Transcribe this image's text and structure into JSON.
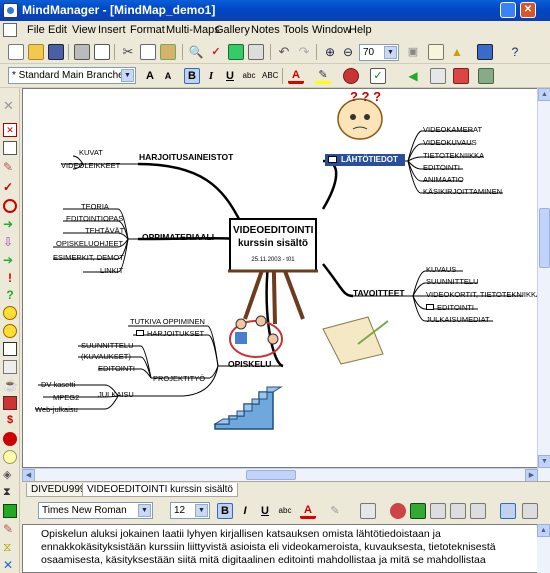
{
  "window": {
    "title": "MindManager - [MindMap_demo1]"
  },
  "menu": [
    "File",
    "Edit",
    "View",
    "Insert",
    "Format",
    "Multi-Maps",
    "Gallery",
    "Notes",
    "Tools",
    "Window",
    "Help"
  ],
  "toolbar": {
    "zoom": "70",
    "style": "* Standard Main Branches"
  },
  "notes_toolbar": {
    "font": "Times New Roman",
    "size": "12"
  },
  "map": {
    "central": {
      "line1": "VIDEOEDITOINTI",
      "line2": "kurssin sisältö",
      "date": "25.11.2003 - t01"
    },
    "branches": {
      "harjoitus": {
        "label": "HARJOITUSAINEISTOT",
        "children": [
          "KUVAT",
          "VIDEOLEIKKEET"
        ]
      },
      "oppimateriaali": {
        "label": "OPPIMATERIAALI",
        "children": [
          "TEORIA",
          "EDITOINTIOPAS",
          "TEHTÄVÄT",
          "OPISKELUOHJEET",
          "ESIMERKIT, DEMOT",
          "LINKIT"
        ]
      },
      "lahtotiedot": {
        "label": "LÄHTÖTIEDOT",
        "children": [
          "VIDEOKAMERAT",
          "VIDEOKUVAUS",
          "TIETOTEKNIIKKA",
          "EDITOINTI",
          "ANIMAATIO",
          "KÄSIKIRJOITTAMINEN"
        ]
      },
      "tavoitteet": {
        "label": "TAVOITTEET",
        "children": [
          "KUVAUS",
          "SUUNNITTELU",
          "VIDEOKORTIT, TIETOTEKNIIKKA",
          "EDITOINTI",
          "JULKAISUMEDIAT"
        ]
      },
      "opiskelu": {
        "label": "OPISKELU",
        "children": [
          "TUTKIVA OPPIMINEN",
          "HARJOITUKSET"
        ],
        "projektityo": {
          "label": "PROJEKTITYÖ",
          "children": [
            "SUUNNITTELU",
            "(KUVAUKSET)",
            "EDITOINTI"
          ]
        },
        "julkaisu": {
          "label": "JULKAISU",
          "children": [
            "DV-kasetti",
            "MPEG2",
            "Web-julkaisu"
          ]
        }
      }
    }
  },
  "tabs": [
    "DIVEDU999",
    "VIDEOEDITOINTI kurssin sisältö"
  ],
  "notes": {
    "text": "Opiskelun aluksi jokainen laatii lyhyen kirjallisen katsauksen omista lähtötiedoistaan ja ennakkokäsityksistään kurssiin liittyvistä asioista eli videokameroista, kuvauksesta, tietoteknisestä osaamisesta, käsityksestään siitä mitä digitaalinen editointi mahdollistaa ja mitä se mahdollistaa"
  },
  "colors": {
    "title_bar": "#0a5fd8",
    "branch_line": "#000000",
    "lahtotiedot_fill": "#2a4f9a"
  }
}
